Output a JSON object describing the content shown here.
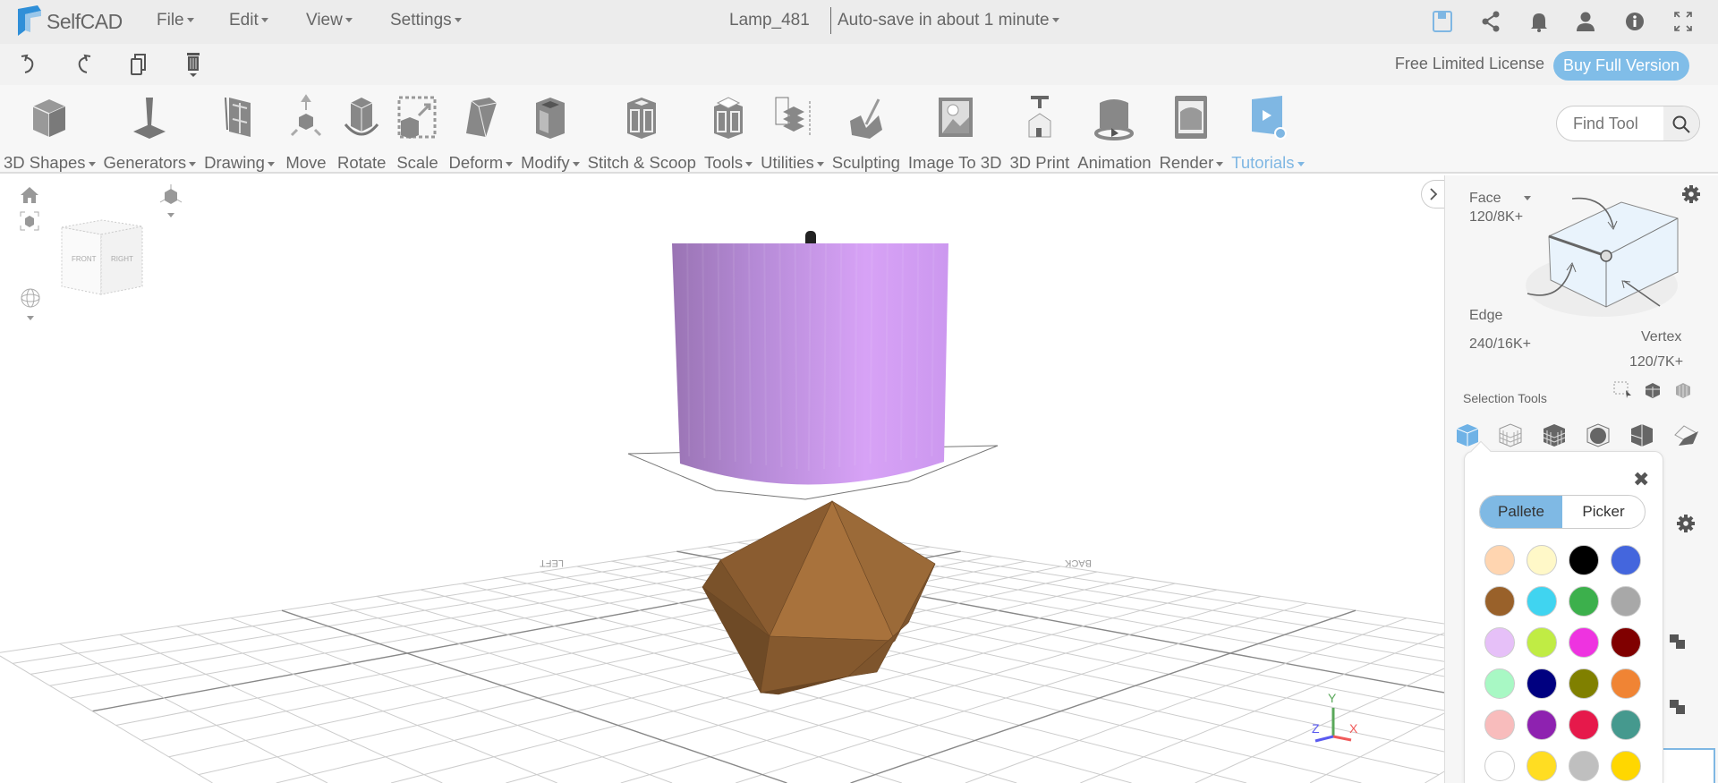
{
  "app": {
    "name": "SelfCAD"
  },
  "menus": [
    {
      "label": "File"
    },
    {
      "label": "Edit"
    },
    {
      "label": "View"
    },
    {
      "label": "Settings"
    }
  ],
  "document": {
    "title": "Lamp_481",
    "autosave": "Auto-save in about 1 minute"
  },
  "top_icons": [
    "save-icon",
    "share-icon",
    "bell-icon",
    "user-icon",
    "info-icon",
    "fullscreen-icon"
  ],
  "edit_icons": [
    "undo-icon",
    "redo-icon",
    "copy-icon",
    "delete-icon"
  ],
  "license": {
    "text": "Free Limited License",
    "buy_label": "Buy Full Version"
  },
  "tools": [
    {
      "label": "3D Shapes",
      "dropdown": true
    },
    {
      "label": "Generators",
      "dropdown": true
    },
    {
      "label": "Drawing",
      "dropdown": true
    },
    {
      "label": "Move",
      "dropdown": false
    },
    {
      "label": "Rotate",
      "dropdown": false
    },
    {
      "label": "Scale",
      "dropdown": false
    },
    {
      "label": "Deform",
      "dropdown": true
    },
    {
      "label": "Modify",
      "dropdown": true
    },
    {
      "label": "Stitch & Scoop",
      "dropdown": false
    },
    {
      "label": "Tools",
      "dropdown": true
    },
    {
      "label": "Utilities",
      "dropdown": true
    },
    {
      "label": "Sculpting",
      "dropdown": false
    },
    {
      "label": "Image To 3D",
      "dropdown": false
    },
    {
      "label": "3D Print",
      "dropdown": false
    },
    {
      "label": "Animation",
      "dropdown": false
    },
    {
      "label": "Render",
      "dropdown": true
    },
    {
      "label": "Tutorials",
      "dropdown": true
    }
  ],
  "find_tool": {
    "placeholder": "Find Tool"
  },
  "viewcube": {
    "front": "FRONT",
    "right": "RIGHT"
  },
  "grid_labels": {
    "left": "LEFT",
    "back": "BACK"
  },
  "axes": {
    "x": "X",
    "y": "Y",
    "z": "Z",
    "x_color": "#f05a5a",
    "y_color": "#5aa85a",
    "z_color": "#5a5af0"
  },
  "selection": {
    "face_label": "Face",
    "face_count": "120/8K+",
    "edge_label": "Edge",
    "edge_count": "240/16K+",
    "vertex_label": "Vertex",
    "vertex_count": "120/7K+",
    "tools_label": "Selection Tools"
  },
  "color_popup": {
    "tabs": [
      {
        "label": "Pallete",
        "active": true
      },
      {
        "label": "Picker",
        "active": false
      }
    ],
    "colors": [
      "#ffd5b0",
      "#fff8c8",
      "#000000",
      "#4466dd",
      "#99612a",
      "#40d4f0",
      "#3cb04c",
      "#a8a8a8",
      "#e6c0f8",
      "#c0ec44",
      "#ee33e0",
      "#800000",
      "#a8f8c4",
      "#000080",
      "#808000",
      "#f08434",
      "#f8bcbc",
      "#8e22b0",
      "#e6194b",
      "#45998e",
      "#ffffff",
      "#ffdd22",
      "#bfbfbf",
      "#ffd700"
    ]
  },
  "accent": "#7fb9e4"
}
